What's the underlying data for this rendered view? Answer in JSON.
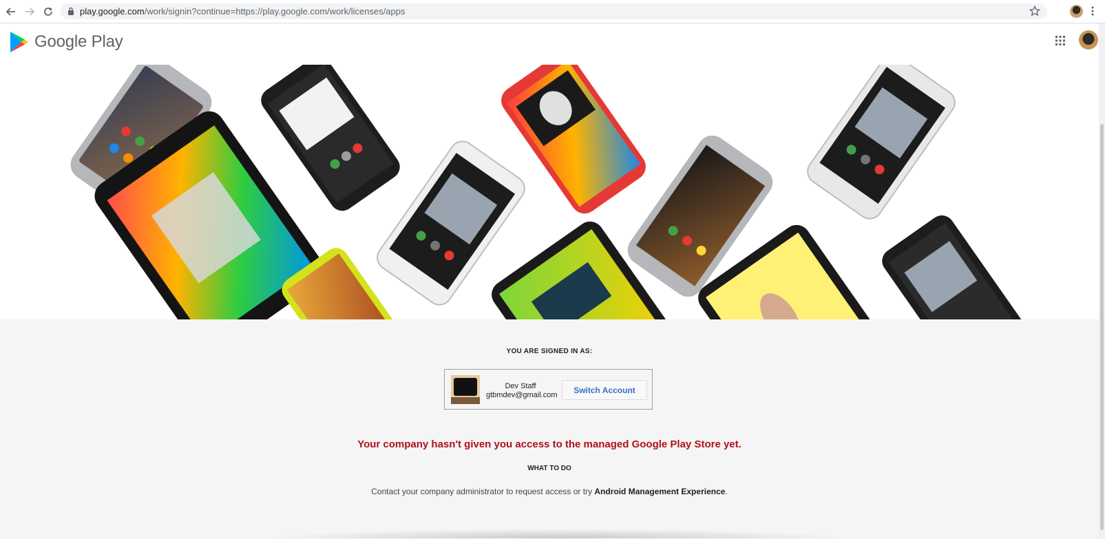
{
  "browser": {
    "url_host": "play.google.com",
    "url_path": "/work/signin?continue=https://play.google.com/work/licenses/apps"
  },
  "header": {
    "logo_text": "Google Play"
  },
  "signin": {
    "label": "YOU ARE SIGNED IN AS:",
    "name": "Dev Staff",
    "email": "gtbmdev@gmail.com",
    "switch_label": "Switch Account"
  },
  "message": {
    "error": "Your company hasn't given you access to the managed Google Play Store yet.",
    "what_to_do": "WHAT TO DO",
    "contact_prefix": "Contact your company administrator to request access or try ",
    "contact_link": "Android Management Experience",
    "contact_suffix": "."
  },
  "colors": {
    "error": "#b0101b",
    "link": "#3a6fc4"
  }
}
